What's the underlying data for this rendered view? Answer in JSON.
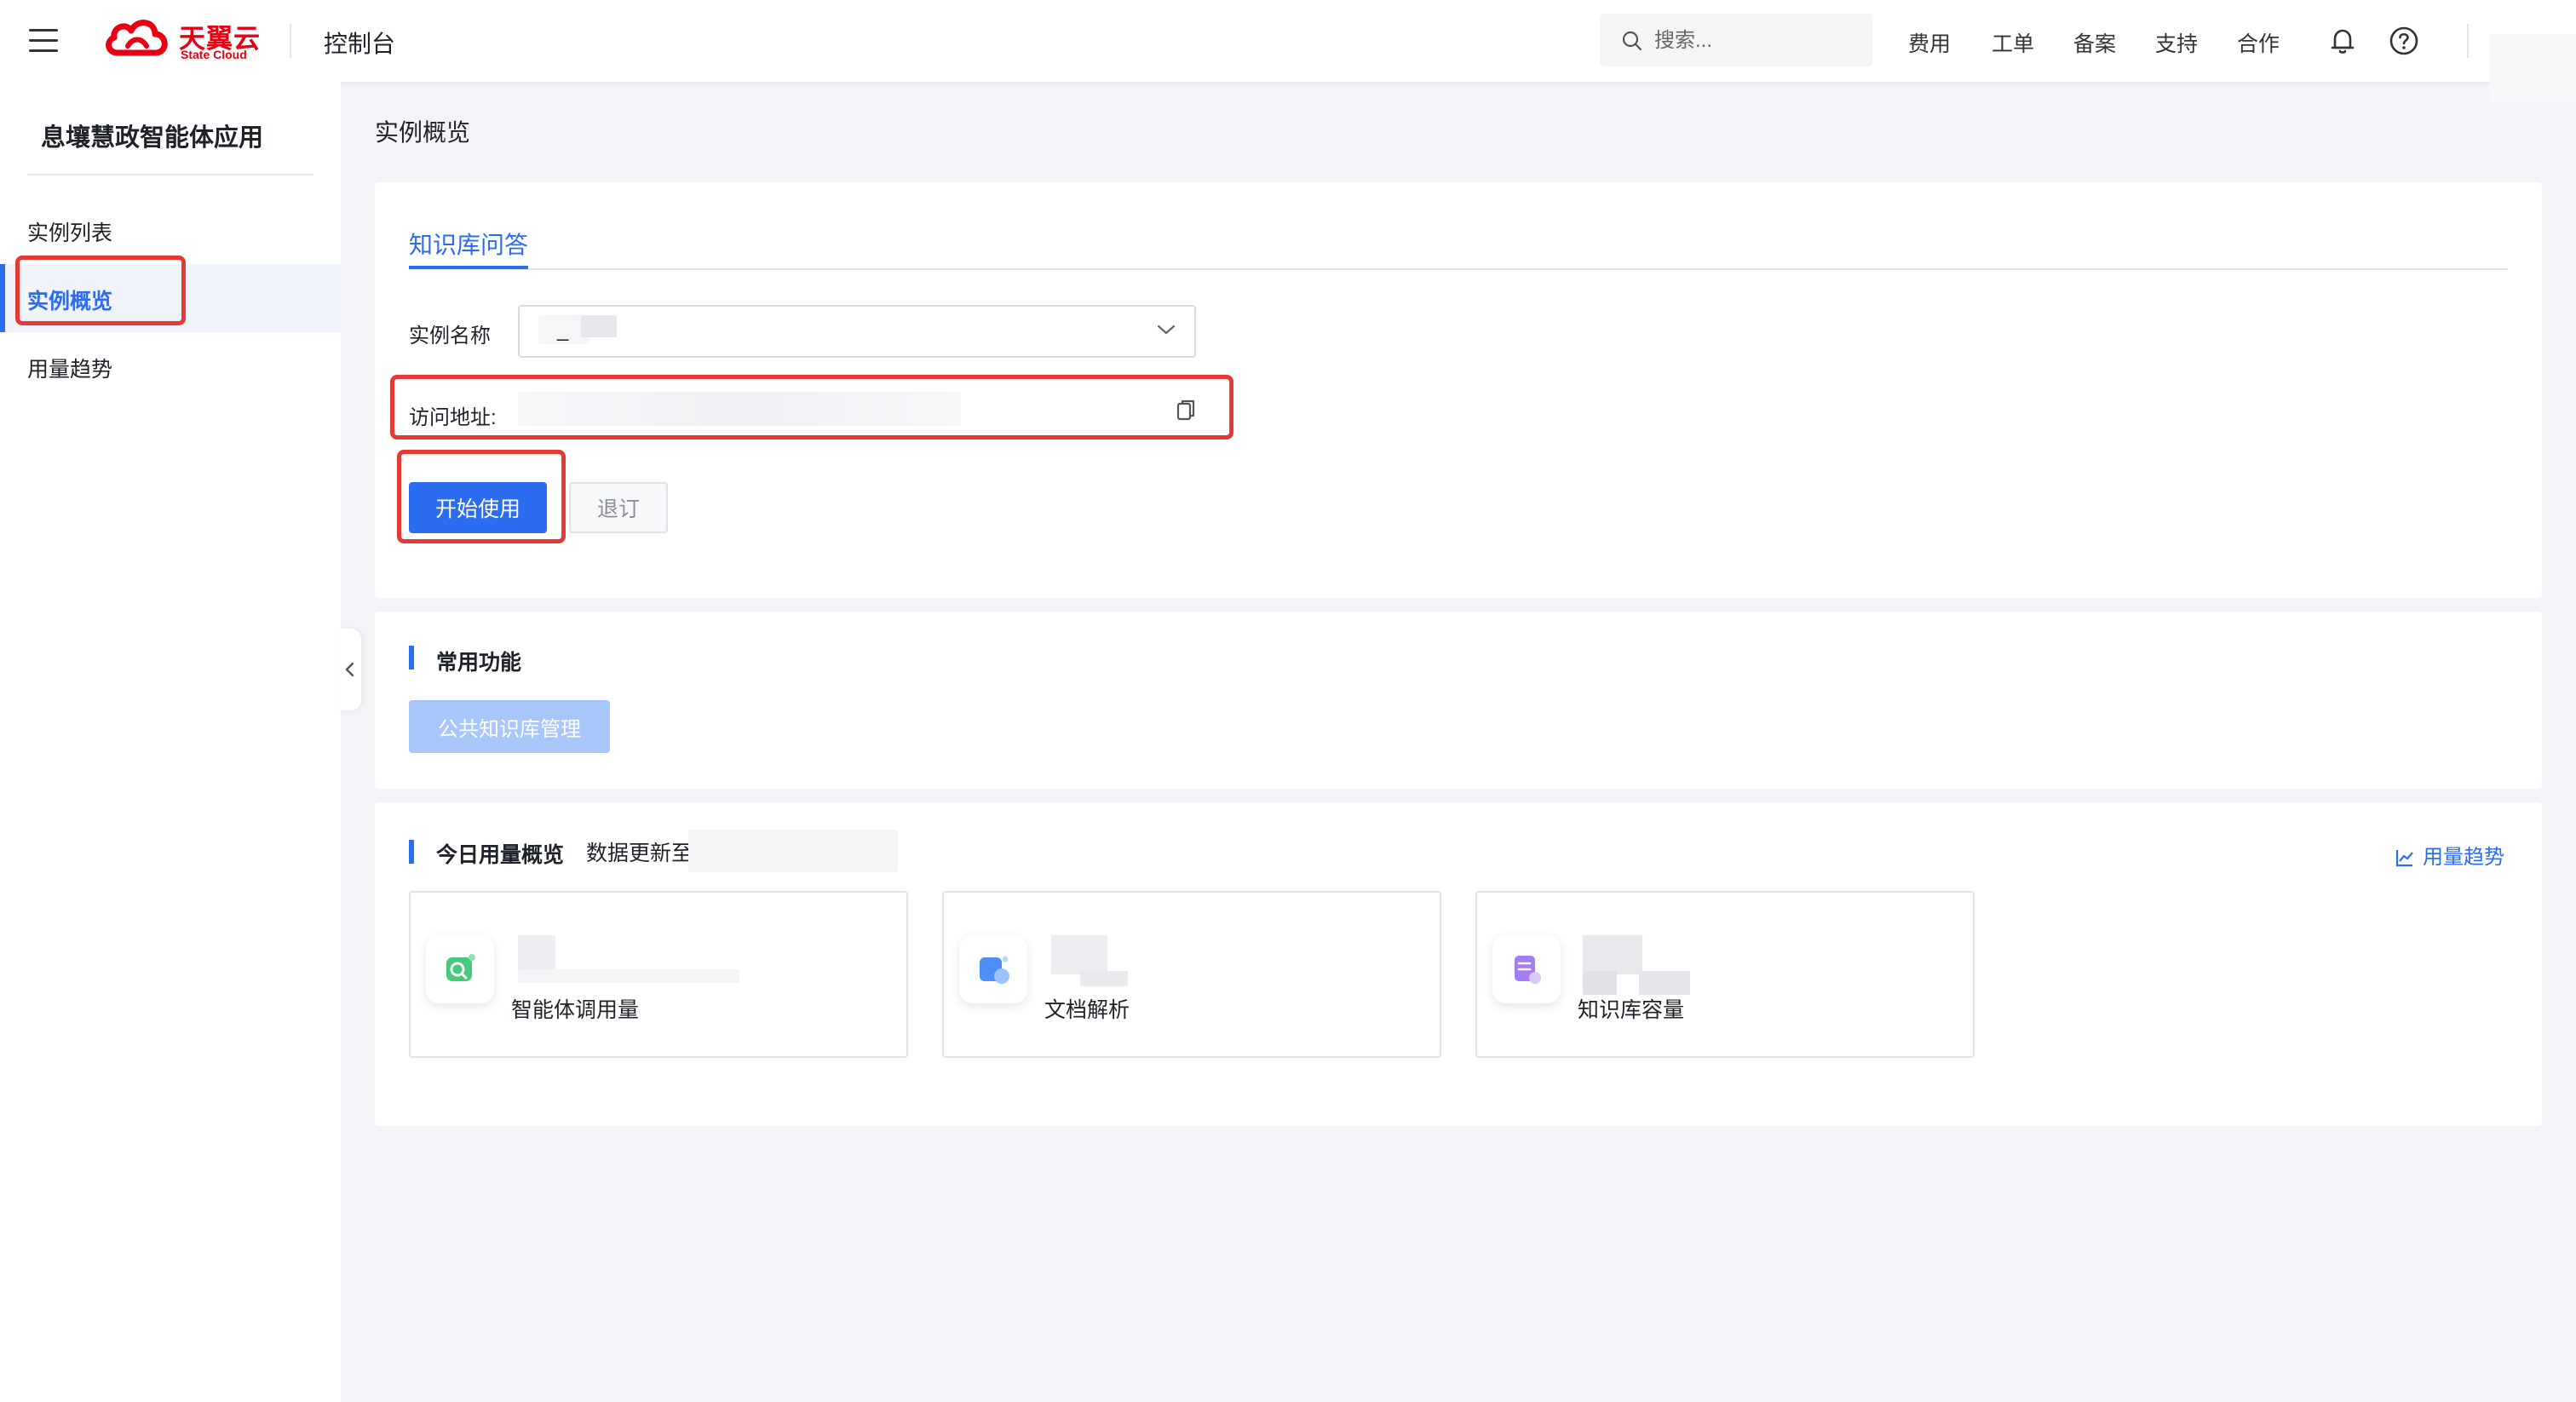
{
  "topbar": {
    "brand_name": "天翼云",
    "brand_sub": "State Cloud",
    "console_title": "控制台",
    "search_placeholder": "搜索...",
    "nav": [
      "费用",
      "工单",
      "备案",
      "支持",
      "合作"
    ],
    "icons": {
      "menu": "hamburger-icon",
      "logo": "cloud-logo-icon",
      "search": "search-icon",
      "bell": "bell-icon",
      "help": "help-icon"
    }
  },
  "sidebar": {
    "title": "息壤慧政智能体应用",
    "items": [
      {
        "label": "实例列表",
        "active": false
      },
      {
        "label": "实例概览",
        "active": true
      },
      {
        "label": "用量趋势",
        "active": false
      }
    ]
  },
  "main": {
    "page_title": "实例概览",
    "instance_card": {
      "tab": "知识库问答",
      "name_label": "实例名称",
      "name_value": "_",
      "address_label": "访问地址:",
      "start_button": "开始使用",
      "unsubscribe_button": "退订"
    },
    "common_functions": {
      "title": "常用功能",
      "public_kb_button": "公共知识库管理"
    },
    "usage": {
      "title": "今日用量概览",
      "update_label": "数据更新至",
      "trend_link": "用量趋势",
      "stats": [
        {
          "label": "智能体调用量",
          "icon": "agent-icon"
        },
        {
          "label": "文档解析",
          "icon": "document-icon"
        },
        {
          "label": "知识库容量",
          "icon": "database-icon"
        }
      ]
    }
  },
  "colors": {
    "primary": "#2b6cf0",
    "brand_red": "#e60012",
    "highlight_red": "#e53935",
    "disabled_primary": "#a9c6fb"
  }
}
